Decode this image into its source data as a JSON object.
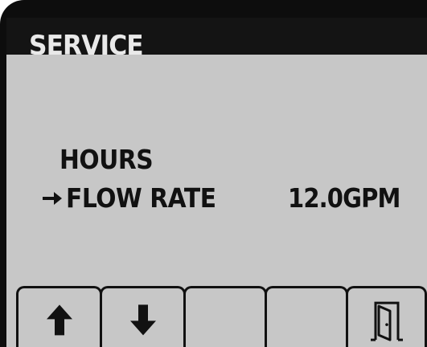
{
  "screen": {
    "title": "SERVICE",
    "menu": [
      {
        "label": "HOURS",
        "value": "",
        "selected": false
      },
      {
        "label": "FLOW RATE",
        "value": "12.0GPM",
        "selected": true
      }
    ]
  },
  "softkeys": [
    {
      "icon": "arrow-up-icon"
    },
    {
      "icon": "arrow-down-icon"
    },
    {
      "icon": ""
    },
    {
      "icon": ""
    },
    {
      "icon": "exit-door-icon"
    }
  ],
  "colors": {
    "lcd_background": "#c7c7c7",
    "bezel": "#0d0d0d",
    "title_text": "#e9e9e9",
    "text": "#111111"
  }
}
